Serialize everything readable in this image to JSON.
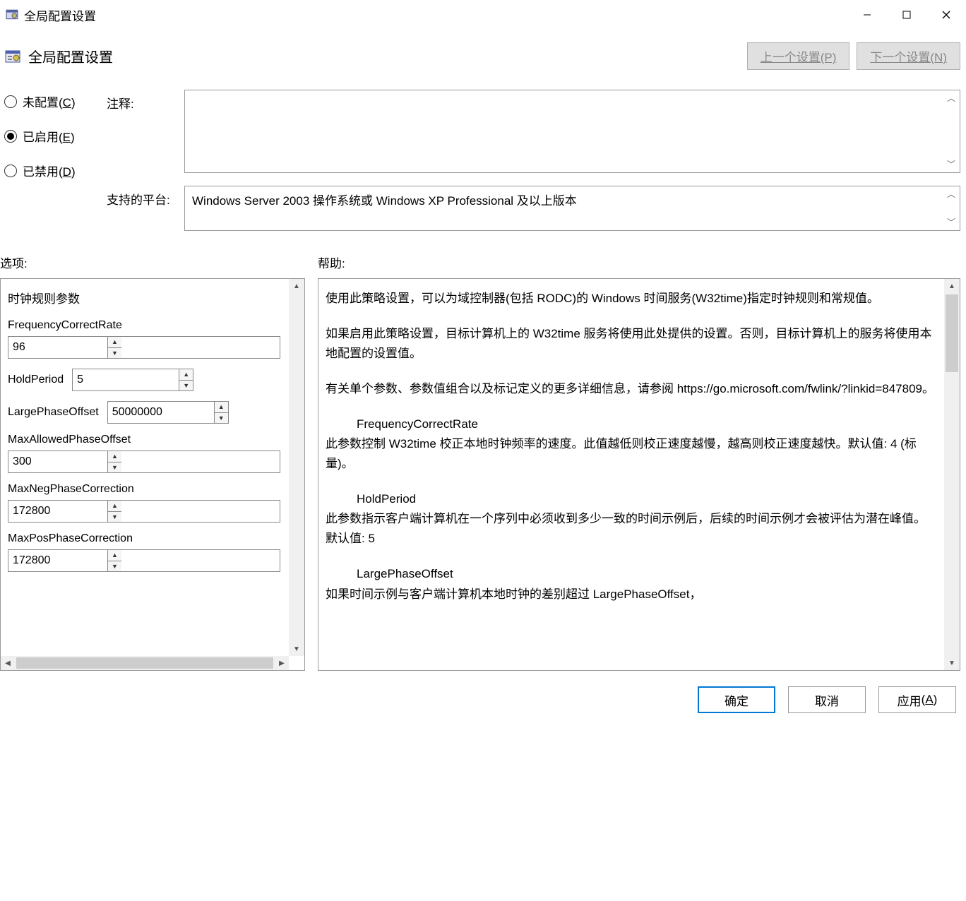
{
  "titlebar": {
    "title": "全局配置设置"
  },
  "header": {
    "title": "全局配置设置",
    "prev_setting": "上一个设置(P)",
    "next_setting": "下一个设置(N)"
  },
  "radios": {
    "not_configured": "未配置",
    "not_configured_key": "C",
    "enabled": "已启用",
    "enabled_key": "E",
    "disabled": "已禁用",
    "disabled_key": "D",
    "selected": "enabled"
  },
  "fields": {
    "comment_label": "注释:",
    "comment_value": "",
    "platform_label": "支持的平台:",
    "platform_value": "Windows Server 2003 操作系统或 Windows XP Professional 及以上版本"
  },
  "sections": {
    "options_label": "选项:",
    "help_label": "帮助:"
  },
  "options": {
    "heading": "时钟规则参数",
    "params": [
      {
        "label": "FrequencyCorrectRate",
        "value": "96",
        "inline": false
      },
      {
        "label": "HoldPeriod",
        "value": "5",
        "inline": true
      },
      {
        "label": "LargePhaseOffset",
        "value": "50000000",
        "inline": true
      },
      {
        "label": "MaxAllowedPhaseOffset",
        "value": "300",
        "inline": false
      },
      {
        "label": "MaxNegPhaseCorrection",
        "value": "172800",
        "inline": false
      },
      {
        "label": "MaxPosPhaseCorrection",
        "value": "172800",
        "inline": false
      }
    ]
  },
  "help": {
    "p1": "使用此策略设置，可以为域控制器(包括 RODC)的 Windows 时间服务(W32time)指定时钟规则和常规值。",
    "p2": "如果启用此策略设置，目标计算机上的 W32time 服务将使用此处提供的设置。否则，目标计算机上的服务将使用本地配置的设置值。",
    "p3": "有关单个参数、参数值组合以及标记定义的更多详细信息，请参阅 https://go.microsoft.com/fwlink/?linkid=847809。",
    "h1": "FrequencyCorrectRate",
    "d1": "此参数控制 W32time 校正本地时钟频率的速度。此值越低则校正速度越慢，越高则校正速度越快。默认值: 4 (标量)。",
    "h2": "HoldPeriod",
    "d2": "此参数指示客户端计算机在一个序列中必须收到多少一致的时间示例后，后续的时间示例才会被评估为潜在峰值。默认值: 5",
    "h3": "LargePhaseOffset",
    "d3": "如果时间示例与客户端计算机本地时钟的差别超过 LargePhaseOffset，"
  },
  "buttons": {
    "ok": "确定",
    "cancel": "取消",
    "apply": "应用",
    "apply_key": "A"
  }
}
